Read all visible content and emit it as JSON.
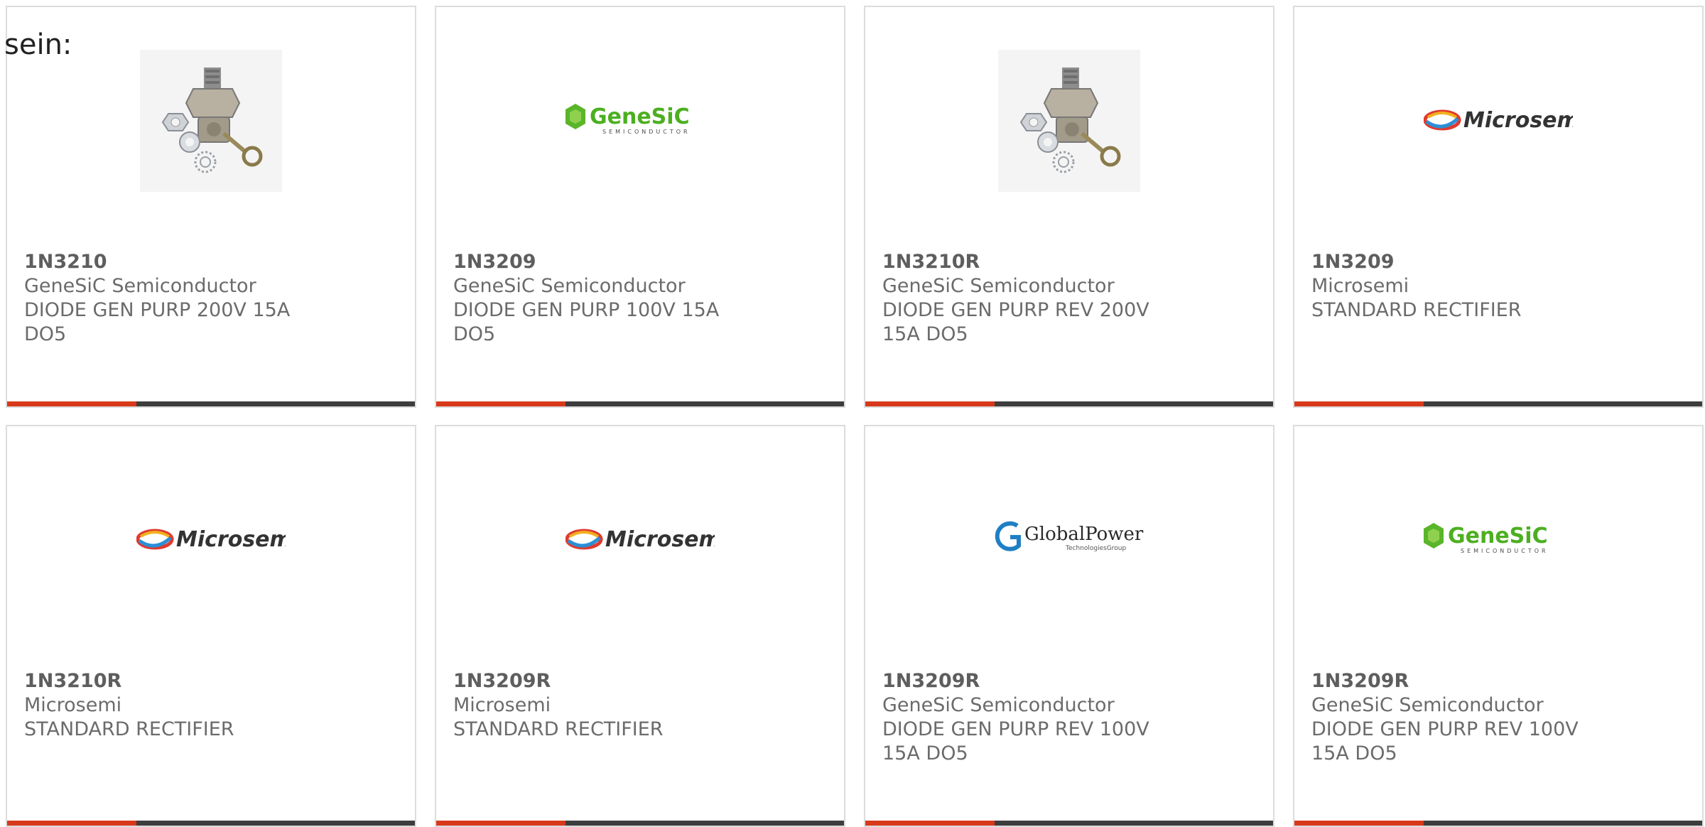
{
  "intro_text": "sein:",
  "colors": {
    "accent": "#d8391b",
    "bar": "#3d3d3d",
    "text": "#6b6b6b",
    "border": "#dcdcdc"
  },
  "products": [
    {
      "part": "1N3210",
      "maker": "GeneSiC Semiconductor",
      "desc": "DIODE GEN PURP 200V 15A DO5",
      "image": "diode-stud-photo"
    },
    {
      "part": "1N3209",
      "maker": "GeneSiC Semiconductor",
      "desc": "DIODE GEN PURP 100V 15A DO5",
      "image": "genesic-logo"
    },
    {
      "part": "1N3210R",
      "maker": "GeneSiC Semiconductor",
      "desc": "DIODE GEN PURP REV 200V 15A DO5",
      "image": "diode-stud-photo"
    },
    {
      "part": "1N3209",
      "maker": "Microsemi",
      "desc": "STANDARD RECTIFIER",
      "image": "microsemi-logo"
    },
    {
      "part": "1N3210R",
      "maker": "Microsemi",
      "desc": "STANDARD RECTIFIER",
      "image": "microsemi-logo"
    },
    {
      "part": "1N3209R",
      "maker": "Microsemi",
      "desc": "STANDARD RECTIFIER",
      "image": "microsemi-logo"
    },
    {
      "part": "1N3209R",
      "maker": "GeneSiC Semiconductor",
      "desc": "DIODE GEN PURP REV 100V 15A DO5",
      "image": "globalpower-logo"
    },
    {
      "part": "1N3209R",
      "maker": "GeneSiC Semiconductor",
      "desc": "DIODE GEN PURP REV 100V 15A DO5",
      "image": "genesic-logo"
    }
  ],
  "logos": {
    "genesic": {
      "name": "GeneSiC",
      "sub": "SEMICONDUCTOR"
    },
    "microsemi": {
      "name": "Microsemi"
    },
    "globalpower": {
      "name": "GlobalPower",
      "sub": "TechnologiesGroup"
    }
  }
}
